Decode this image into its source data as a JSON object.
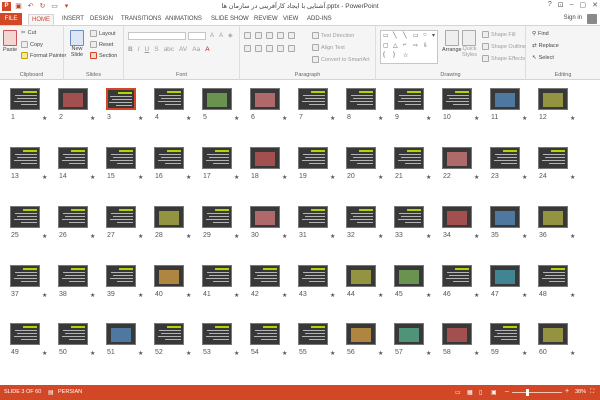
{
  "window": {
    "title": "آشنایی با ایجاد کارآفرینی در سازمان ها.pptx - PowerPoint",
    "controls": [
      "?",
      "⊡",
      "–",
      "▢",
      "✕"
    ],
    "app_logo": "P"
  },
  "tabs": {
    "items": [
      "FILE",
      "HOME",
      "INSERT",
      "DESIGN",
      "TRANSITIONS",
      "ANIMATIONS",
      "SLIDE SHOW",
      "REVIEW",
      "VIEW",
      "ADD-INS"
    ],
    "active": "HOME",
    "sign_in": "Sign in"
  },
  "ribbon": {
    "clipboard": {
      "label": "Clipboard",
      "paste": "Paste",
      "cut": "Cut",
      "copy": "Copy",
      "format_painter": "Format Painter"
    },
    "slides": {
      "label": "Slides",
      "new_slide": "New",
      "new_slide_2": "Slide",
      "layout": "Layout",
      "reset": "Reset",
      "section": "Section"
    },
    "font": {
      "label": "Font"
    },
    "paragraph": {
      "label": "Paragraph",
      "text_direction": "Text Direction",
      "align_text": "Align Text",
      "convert": "Convert to SmartArt"
    },
    "drawing": {
      "label": "Drawing",
      "arrange": "Arrange",
      "quick_styles": "Quick",
      "quick_styles_2": "Styles",
      "shape_fill": "Shape Fill",
      "shape_outline": "Shape Outline",
      "shape_effects": "Shape Effects"
    },
    "editing": {
      "label": "Editing",
      "find": "Find",
      "replace": "Replace",
      "select": "Select"
    }
  },
  "sorter": {
    "selected_slide": 3,
    "transition_marker": "★",
    "slides": [
      "1",
      "2",
      "3",
      "4",
      "5",
      "6",
      "7",
      "8",
      "9",
      "10",
      "11",
      "12",
      "13",
      "14",
      "15",
      "16",
      "17",
      "18",
      "19",
      "20",
      "21",
      "22",
      "23",
      "24",
      "25",
      "26",
      "27",
      "28",
      "29",
      "30",
      "31",
      "32",
      "33",
      "34",
      "35",
      "36",
      "37",
      "38",
      "39",
      "40",
      "41",
      "42",
      "43",
      "44",
      "45",
      "46",
      "47",
      "48",
      "49",
      "50",
      "51",
      "52",
      "53",
      "54",
      "55",
      "56",
      "57",
      "58",
      "59",
      "60"
    ]
  },
  "status": {
    "slide_info": "SLIDE 3 OF 60",
    "language": "PERSIAN",
    "zoom": "38%",
    "zoom_minus": "–",
    "zoom_plus": "+"
  },
  "colors": {
    "accent": "#d24726",
    "thumb_bg": "#383838",
    "title_green": "#b4d400"
  }
}
